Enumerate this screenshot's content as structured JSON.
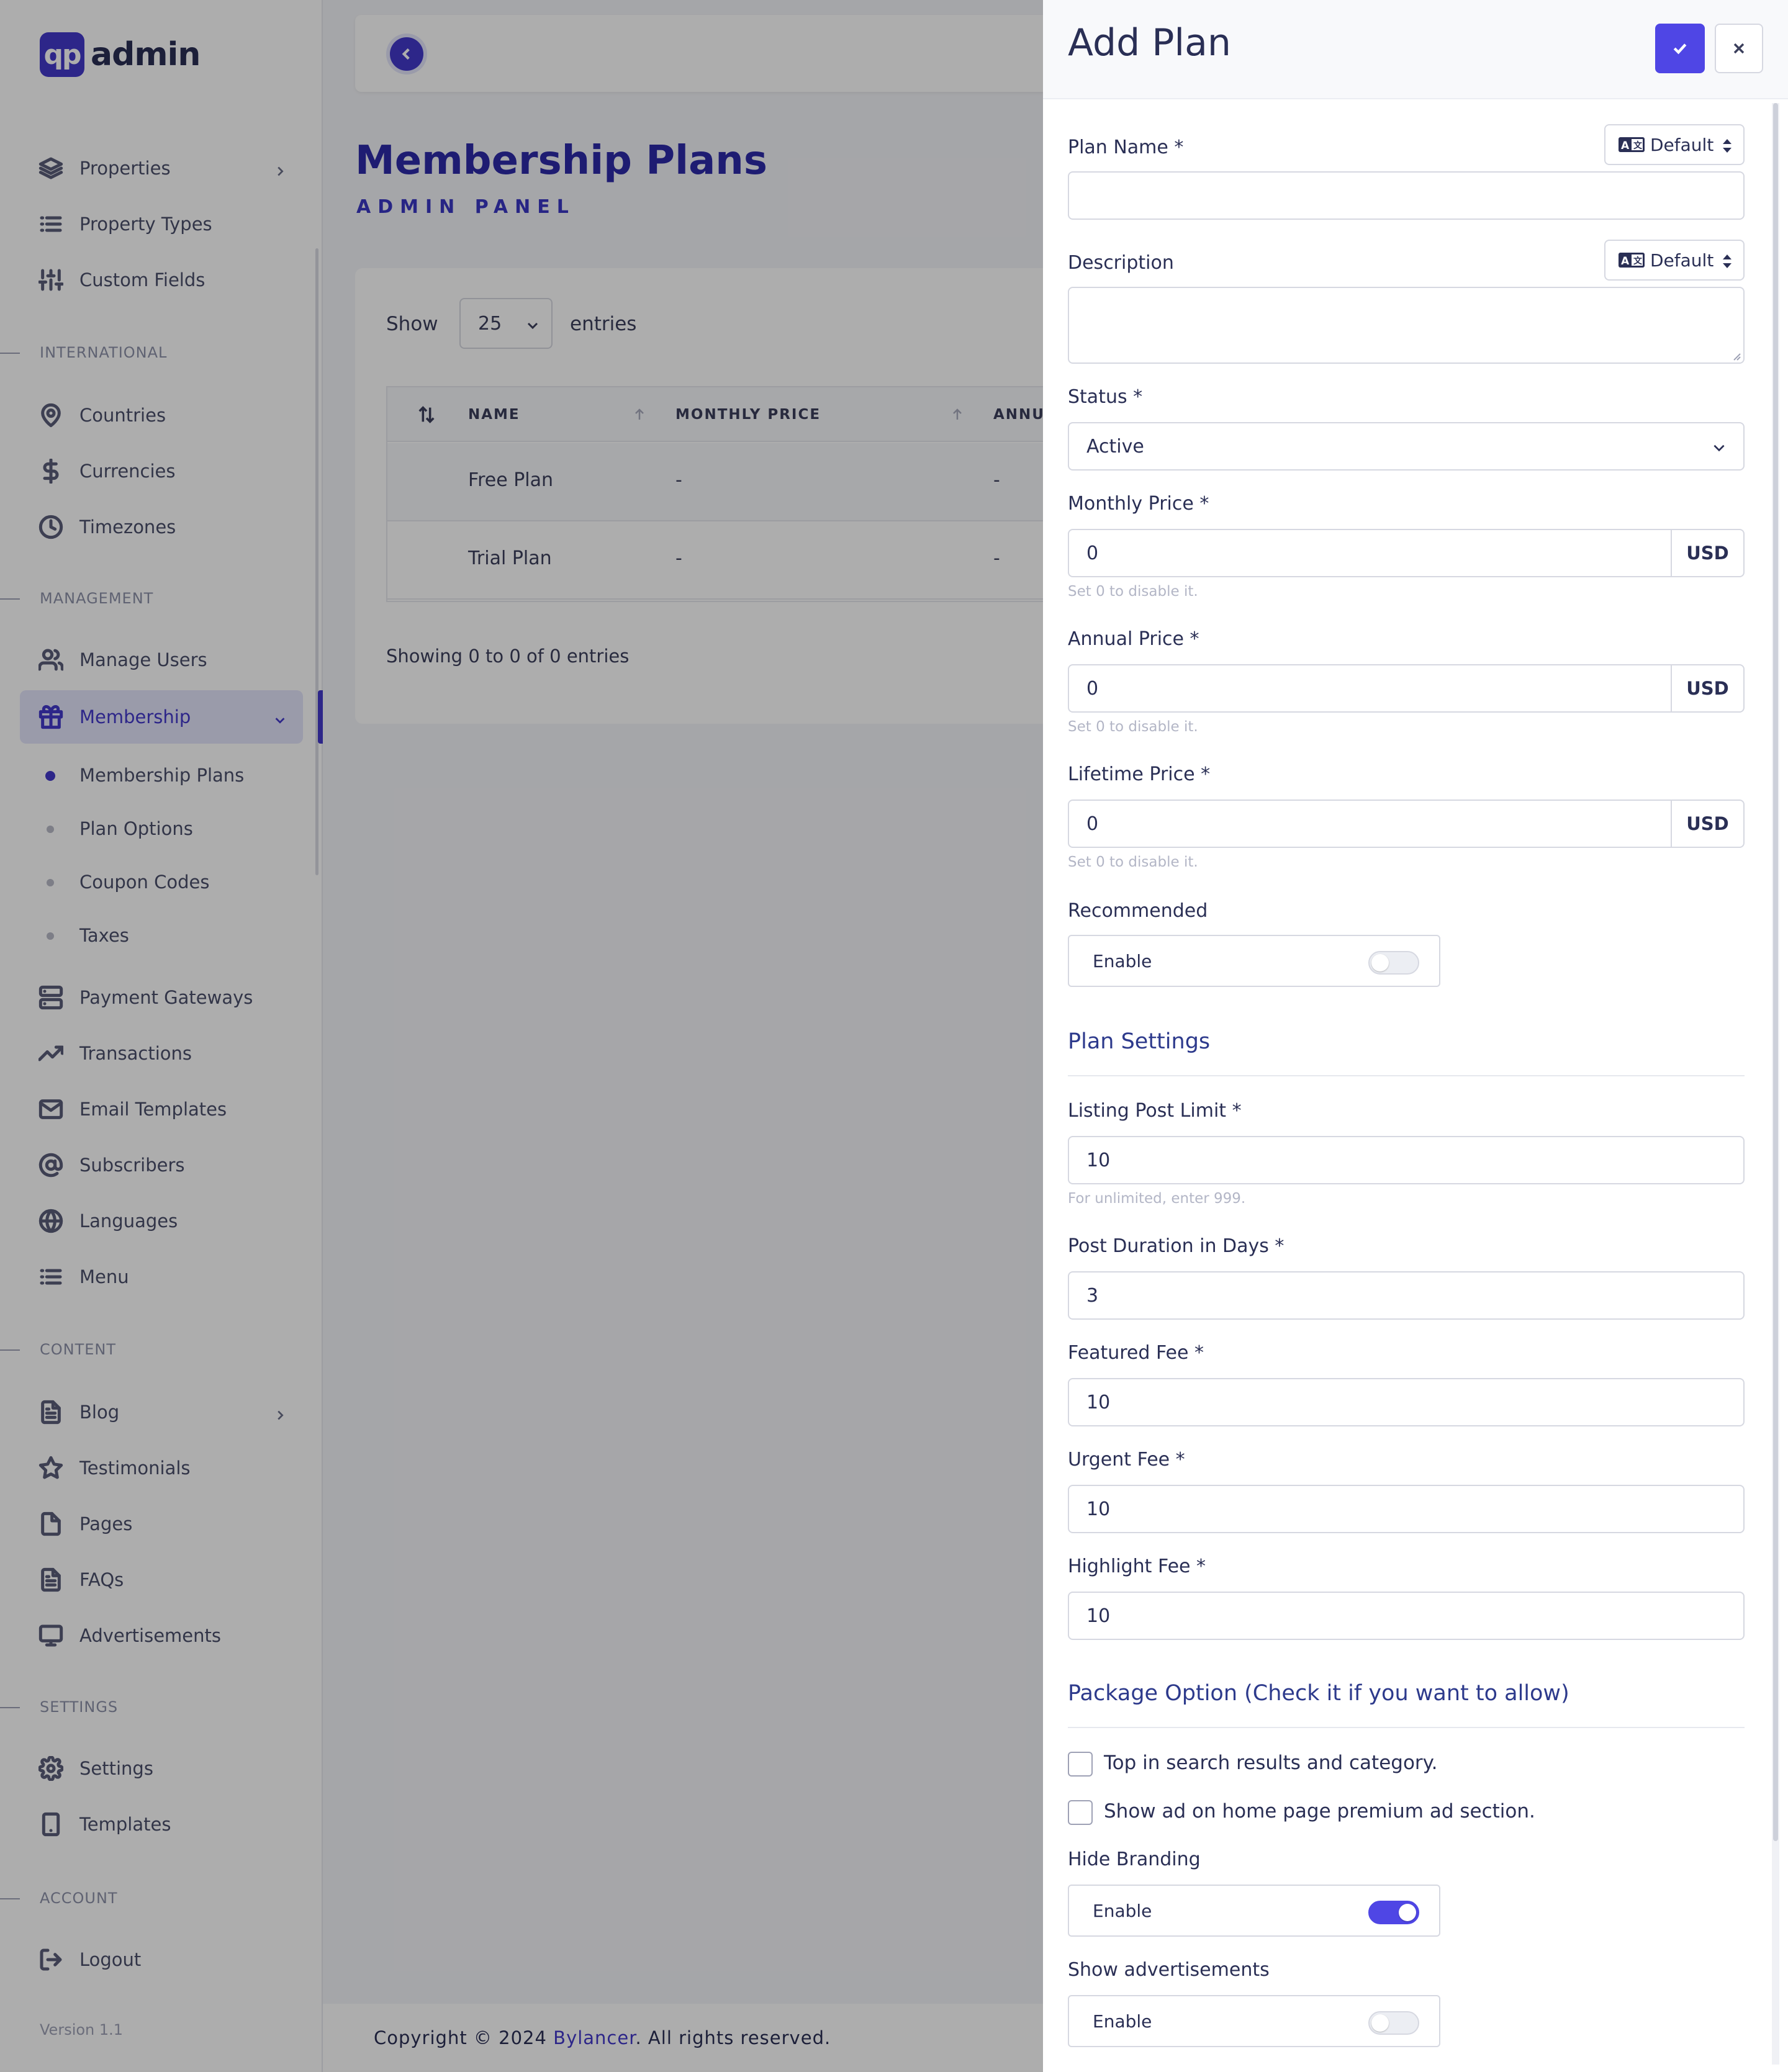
{
  "brand": {
    "logo_mark": "qp",
    "name": "admin"
  },
  "sidebar": {
    "items": {
      "properties": {
        "label": "Properties",
        "icon": "layers-icon"
      },
      "property_types": {
        "label": "Property Types",
        "icon": "list-icon"
      },
      "custom_fields": {
        "label": "Custom Fields",
        "icon": "sliders-icon"
      },
      "countries": {
        "label": "Countries",
        "icon": "map-pin-icon"
      },
      "currencies": {
        "label": "Currencies",
        "icon": "dollar-icon"
      },
      "timezones": {
        "label": "Timezones",
        "icon": "clock-icon"
      },
      "manage_users": {
        "label": "Manage Users",
        "icon": "users-icon"
      },
      "membership": {
        "label": "Membership",
        "icon": "gift-icon"
      },
      "payment_gateways": {
        "label": "Payment Gateways",
        "icon": "server-icon"
      },
      "transactions": {
        "label": "Transactions",
        "icon": "trending-up-icon"
      },
      "email_templates": {
        "label": "Email Templates",
        "icon": "mail-icon"
      },
      "subscribers": {
        "label": "Subscribers",
        "icon": "at-sign-icon"
      },
      "languages": {
        "label": "Languages",
        "icon": "globe-icon"
      },
      "menu": {
        "label": "Menu",
        "icon": "list-icon"
      },
      "blog": {
        "label": "Blog",
        "icon": "file-text-icon"
      },
      "testimonials": {
        "label": "Testimonials",
        "icon": "star-icon"
      },
      "pages": {
        "label": "Pages",
        "icon": "file-icon"
      },
      "faqs": {
        "label": "FAQs",
        "icon": "file-text-icon"
      },
      "advertisements": {
        "label": "Advertisements",
        "icon": "monitor-icon"
      },
      "settings": {
        "label": "Settings",
        "icon": "gear-icon"
      },
      "templates": {
        "label": "Templates",
        "icon": "tablet-icon"
      },
      "logout": {
        "label": "Logout",
        "icon": "logout-icon"
      }
    },
    "sections": {
      "international": "INTERNATIONAL",
      "management": "MANAGEMENT",
      "content": "CONTENT",
      "settings": "SETTINGS",
      "account": "ACCOUNT"
    },
    "membership_sub": {
      "plans": "Membership Plans",
      "options": "Plan Options",
      "coupons": "Coupon Codes",
      "taxes": "Taxes"
    },
    "version": "Version 1.1"
  },
  "main": {
    "title": "Membership Plans",
    "subtitle": "ADMIN PANEL",
    "show_label": "Show",
    "entries_value": "25",
    "entries_label": "entries",
    "table": {
      "headers": [
        "NAME",
        "MONTHLY PRICE",
        "ANNU"
      ],
      "rows": [
        [
          "Free Plan",
          "-",
          "-"
        ],
        [
          "Trial Plan",
          "-",
          "-"
        ]
      ]
    },
    "showing": "Showing 0 to 0 of 0 entries",
    "footer": {
      "prefix": "Copyright © 2024 ",
      "link": "Bylancer",
      "suffix": ". All rights reserved."
    }
  },
  "drawer": {
    "title": "Add Plan",
    "lang_default": "Default",
    "plan_name_label": "Plan Name *",
    "plan_name_value": "",
    "description_label": "Description",
    "status_label": "Status *",
    "status_value": "Active",
    "monthly_label": "Monthly Price *",
    "monthly_value": "0",
    "annual_label": "Annual Price *",
    "annual_value": "0",
    "lifetime_label": "Lifetime Price *",
    "lifetime_value": "0",
    "currency": "USD",
    "zero_hint": "Set 0 to disable it.",
    "recommended_label": "Recommended",
    "enable": "Enable",
    "recommended_on": false,
    "plan_settings": "Plan Settings",
    "listing_limit_label": "Listing Post Limit *",
    "listing_limit_value": "10",
    "unlimited_hint": "For unlimited, enter 999.",
    "duration_label": "Post Duration in Days *",
    "duration_value": "3",
    "featured_label": "Featured Fee *",
    "featured_value": "10",
    "urgent_label": "Urgent Fee *",
    "urgent_value": "10",
    "highlight_label": "Highlight Fee *",
    "highlight_value": "10",
    "package_title": "Package Option (Check it if you want to allow)",
    "opt_top": "Top in search results and category.",
    "opt_home": "Show ad on home page premium ad section.",
    "hide_branding_label": "Hide Branding",
    "hide_branding_on": true,
    "show_ads_label": "Show advertisements",
    "show_ads_on": false
  },
  "colors": {
    "accent": "#4338ca",
    "button": "#4f46e5"
  }
}
